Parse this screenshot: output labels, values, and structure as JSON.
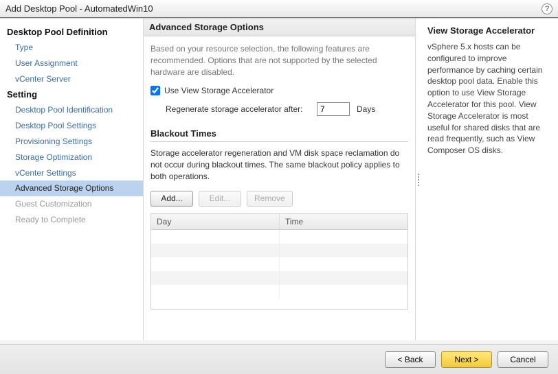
{
  "window": {
    "title": "Add Desktop Pool - AutomatedWin10",
    "help_icon": "?"
  },
  "sidebar": {
    "groups": [
      {
        "heading": "Desktop Pool Definition",
        "items": [
          {
            "label": "Type"
          },
          {
            "label": "User Assignment"
          },
          {
            "label": "vCenter Server"
          }
        ]
      },
      {
        "heading": "Setting",
        "items": [
          {
            "label": "Desktop Pool Identification"
          },
          {
            "label": "Desktop Pool Settings"
          },
          {
            "label": "Provisioning Settings"
          },
          {
            "label": "Storage Optimization"
          },
          {
            "label": "vCenter Settings"
          },
          {
            "label": "Advanced Storage Options",
            "selected": true
          },
          {
            "label": "Guest Customization",
            "disabled": true
          },
          {
            "label": "Ready to Complete",
            "disabled": true
          }
        ]
      }
    ]
  },
  "center": {
    "header": "Advanced Storage Options",
    "description": "Based on your resource selection, the following features are recommended. Options that are not supported by the selected hardware are disabled.",
    "use_accelerator_label": "Use View Storage Accelerator",
    "use_accelerator_checked": true,
    "regenerate_label": "Regenerate storage accelerator after:",
    "regenerate_value": "7",
    "regenerate_unit": "Days",
    "blackout_header": "Blackout Times",
    "blackout_desc": "Storage accelerator regeneration and VM disk space reclamation do not occur during blackout times. The same blackout policy applies to both operations.",
    "buttons": {
      "add": "Add...",
      "edit": "Edit...",
      "remove": "Remove"
    },
    "table": {
      "columns": [
        "Day",
        "Time"
      ],
      "rows": [
        {
          "day": "",
          "time": ""
        },
        {
          "day": "",
          "time": ""
        },
        {
          "day": "",
          "time": ""
        },
        {
          "day": "",
          "time": ""
        },
        {
          "day": "",
          "time": ""
        }
      ]
    }
  },
  "rightpanel": {
    "title": "View Storage Accelerator",
    "body": "vSphere 5.x hosts can be configured to improve performance by caching certain desktop pool data. Enable this option to use View Storage Accelerator for this pool. View Storage Accelerator is most useful for shared disks that are read frequently, such as View Composer OS disks."
  },
  "footer": {
    "back": "< Back",
    "next": "Next >",
    "cancel": "Cancel"
  }
}
